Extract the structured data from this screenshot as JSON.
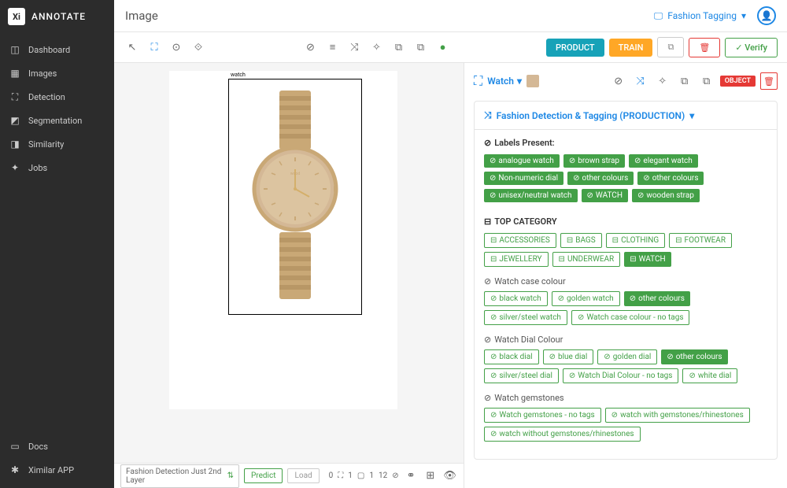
{
  "app": {
    "brand": "ANNOTATE",
    "logo_text": "Xi"
  },
  "sidebar": {
    "items": [
      {
        "icon": "dashboard",
        "label": "Dashboard"
      },
      {
        "icon": "images",
        "label": "Images"
      },
      {
        "icon": "detection",
        "label": "Detection"
      },
      {
        "icon": "segmentation",
        "label": "Segmentation"
      },
      {
        "icon": "similarity",
        "label": "Similarity"
      },
      {
        "icon": "jobs",
        "label": "Jobs"
      }
    ],
    "bottom": [
      {
        "icon": "docs",
        "label": "Docs"
      },
      {
        "icon": "app",
        "label": "Ximilar APP"
      }
    ]
  },
  "header": {
    "title": "Image",
    "workspace_label": "Fashion Tagging"
  },
  "toolbar": {
    "product_btn": "PRODUCT",
    "train_btn": "TRAIN",
    "verify_btn": "Verify"
  },
  "canvas": {
    "bbox_label": "watch",
    "dropdown": "Fashion Detection Just 2nd Layer",
    "predict_btn": "Predict",
    "load_btn": "Load",
    "stats": {
      "bbox_count": "1",
      "poly_count": "1",
      "tag_count": "12"
    }
  },
  "panel": {
    "object_name": "Watch",
    "object_badge": "OBJECT",
    "section_title": "Fashion Detection & Tagging (PRODUCTION)",
    "labels_present_title": "Labels Present:",
    "labels_present": [
      "analogue watch",
      "brown strap",
      "elegant watch",
      "Non-numeric dial",
      "other colours",
      "other colours",
      "unisex/neutral watch",
      "WATCH",
      "wooden strap"
    ],
    "top_category_title": "TOP CATEGORY",
    "top_category": [
      {
        "label": "ACCESSORIES",
        "selected": false
      },
      {
        "label": "BAGS",
        "selected": false
      },
      {
        "label": "CLOTHING",
        "selected": false
      },
      {
        "label": "FOOTWEAR",
        "selected": false
      },
      {
        "label": "JEWELLERY",
        "selected": false
      },
      {
        "label": "UNDERWEAR",
        "selected": false
      },
      {
        "label": "WATCH",
        "selected": true
      }
    ],
    "categories": [
      {
        "title": "Watch case colour",
        "options": [
          {
            "label": "black watch",
            "selected": false
          },
          {
            "label": "golden watch",
            "selected": false
          },
          {
            "label": "other colours",
            "selected": true
          },
          {
            "label": "silver/steel watch",
            "selected": false
          },
          {
            "label": "Watch case colour - no tags",
            "selected": false
          }
        ]
      },
      {
        "title": "Watch Dial Colour",
        "options": [
          {
            "label": "black dial",
            "selected": false
          },
          {
            "label": "blue dial",
            "selected": false
          },
          {
            "label": "golden dial",
            "selected": false
          },
          {
            "label": "other colours",
            "selected": true
          },
          {
            "label": "silver/steel dial",
            "selected": false
          },
          {
            "label": "Watch Dial Colour - no tags",
            "selected": false
          },
          {
            "label": "white dial",
            "selected": false
          }
        ]
      },
      {
        "title": "Watch gemstones",
        "options": [
          {
            "label": "Watch gemstones - no tags",
            "selected": false
          },
          {
            "label": "watch with gemstones/rhinestones",
            "selected": false
          },
          {
            "label": "watch without gemstones/rhinestones",
            "selected": false
          }
        ]
      }
    ]
  },
  "colors": {
    "green": "#43a047",
    "blue": "#1e88e5",
    "red": "#e53935",
    "teal": "#17a2b8",
    "orange": "#ffa726"
  }
}
